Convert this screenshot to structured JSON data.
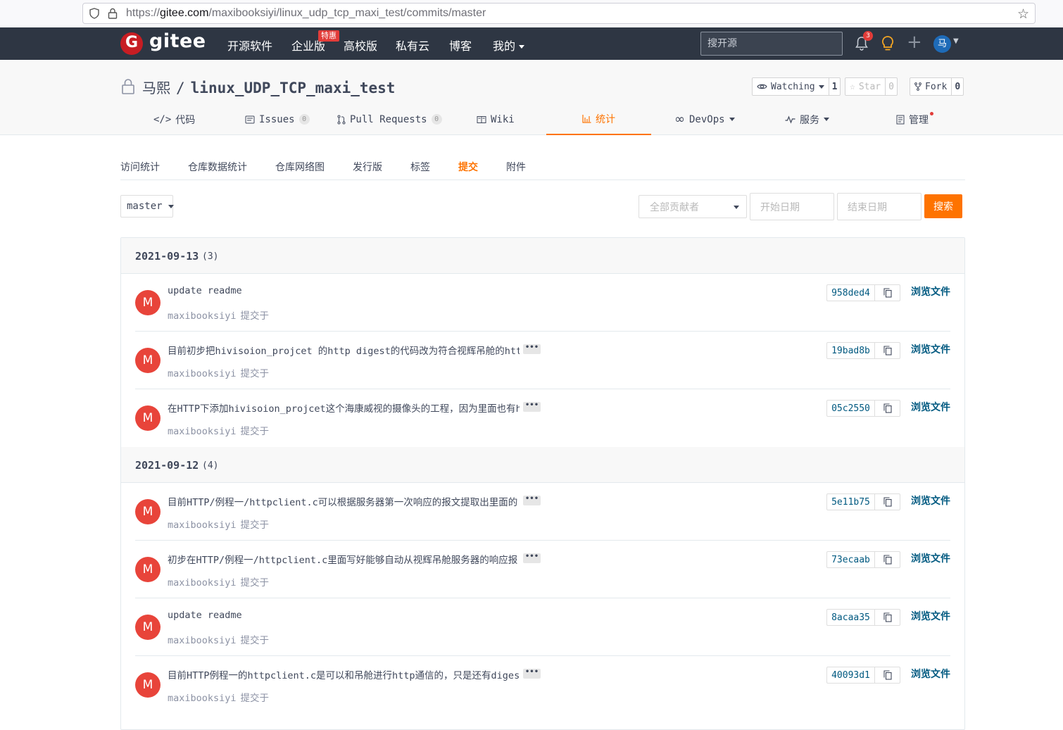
{
  "browser": {
    "url_prefix": "https://",
    "url_host": "gitee.com",
    "url_path": "/maxibooksiyi/linux_udp_tcp_maxi_test/commits/master"
  },
  "topnav": {
    "logo_letter": "G",
    "logo_text": "gitee",
    "items": [
      "开源软件",
      "企业版",
      "高校版",
      "私有云",
      "博客",
      "我的"
    ],
    "badge": "特惠",
    "search_placeholder": "搜开源",
    "notification_count": "3",
    "avatar_letter": "马"
  },
  "repo": {
    "owner": "马熙",
    "separator": "/",
    "name": "linux_UDP_TCP_maxi_test",
    "watch_label": "Watching",
    "watch_count": "1",
    "star_label": "Star",
    "star_count": "0",
    "fork_label": "Fork",
    "fork_count": "0"
  },
  "tabs": {
    "code": "代码",
    "issues": "Issues",
    "issues_count": "0",
    "pulls": "Pull Requests",
    "pulls_count": "0",
    "wiki": "Wiki",
    "stats": "统计",
    "devops": "DevOps",
    "services": "服务",
    "manage": "管理"
  },
  "subtabs": [
    "访问统计",
    "仓库数据统计",
    "仓库网络图",
    "发行版",
    "标签",
    "提交",
    "附件"
  ],
  "filters": {
    "branch": "master",
    "contributors": "全部贡献者",
    "start_date": "开始日期",
    "end_date": "结束日期",
    "search": "搜索"
  },
  "commit_days": [
    {
      "date": "2021-09-13",
      "count": "(3)",
      "commits": [
        {
          "avatar": "M",
          "message": "update readme",
          "has_more": false,
          "author": "maxibooksiyi",
          "committed": "提交于",
          "sha": "958ded4",
          "browse": "浏览文件"
        },
        {
          "avatar": "M",
          "message": "目前初步把hivisoion_projcet 的http digest的代码改为符合视辉吊舱的http d",
          "has_more": true,
          "author": "maxibooksiyi",
          "committed": "提交于",
          "sha": "19bad8b",
          "browse": "浏览文件"
        },
        {
          "avatar": "M",
          "message": "在HTTP下添加hivisoion_projcet这个海康威视的摄像头的工程，因为里面也有ht",
          "has_more": true,
          "author": "maxibooksiyi",
          "committed": "提交于",
          "sha": "05c2550",
          "browse": "浏览文件"
        }
      ]
    },
    {
      "date": "2021-09-12",
      "count": "(4)",
      "commits": [
        {
          "avatar": "M",
          "message": "目前HTTP/例程一/httpclient.c可以根据服务器第一次响应的报文提取出里面的",
          "has_more": true,
          "author": "maxibooksiyi",
          "committed": "提交于",
          "sha": "5e11b75",
          "browse": "浏览文件"
        },
        {
          "avatar": "M",
          "message": "初步在HTTP/例程一/httpclient.c里面写好能够自动从视辉吊舱服务器的响应报",
          "has_more": true,
          "author": "maxibooksiyi",
          "committed": "提交于",
          "sha": "73ecaab",
          "browse": "浏览文件"
        },
        {
          "avatar": "M",
          "message": "update readme",
          "has_more": false,
          "author": "maxibooksiyi",
          "committed": "提交于",
          "sha": "8acaa35",
          "browse": "浏览文件"
        },
        {
          "avatar": "M",
          "message": "目前HTTP例程一的httpclient.c是可以和吊舱进行http通信的，只是还有digest",
          "has_more": true,
          "author": "maxibooksiyi",
          "committed": "提交于",
          "sha": "40093d1",
          "browse": "浏览文件"
        }
      ]
    }
  ],
  "colors": {
    "accent": "#fe7300",
    "nav_bg": "#2e3643",
    "link": "#005980",
    "avatar": "#e8443a"
  },
  "more_glyph": "•••"
}
